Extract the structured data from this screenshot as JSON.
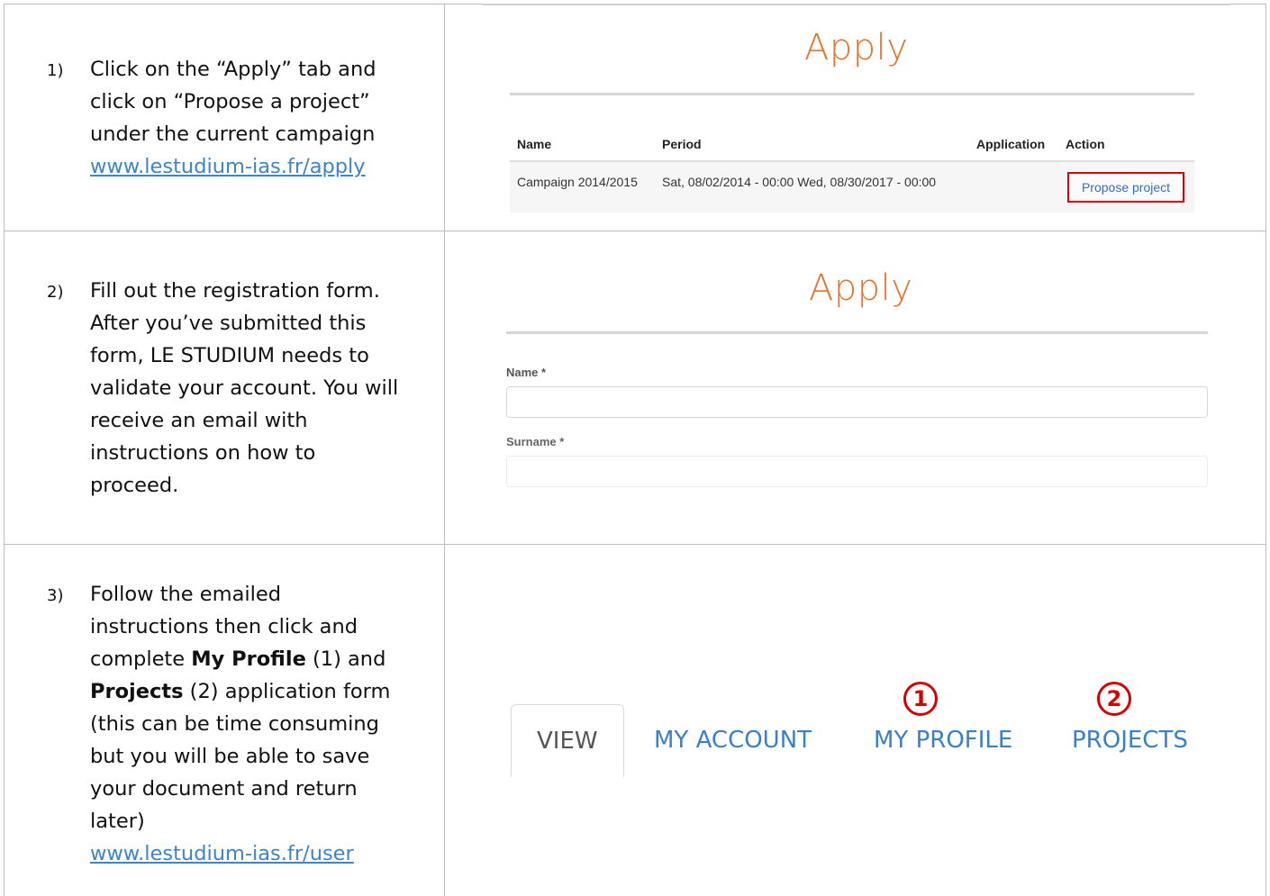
{
  "steps": [
    {
      "number": "1)",
      "text_lines": [
        "Click on the “Apply” tab and click on “Propose a project” under the current campaign"
      ],
      "link": "www.lestudium-ias.fr/apply"
    },
    {
      "number": "2)",
      "text": "Fill out the registration form. After you’ve submitted this form, LE STUDIUM needs to validate your account. You will receive an email with instructions on how to proceed."
    },
    {
      "number": "3)",
      "text_a": "Follow the emailed instructions then click and complete ",
      "bold_1": "My Profile",
      "text_b": " (1) and ",
      "bold_2": "Projects",
      "text_c": " (2) application form (this can be time consuming but you will be able to save your document and return later)",
      "link": "www.lestudium-ias.fr/user"
    }
  ],
  "panel1": {
    "title": "Apply",
    "headers": {
      "name": "Name",
      "period": "Period",
      "application": "Application",
      "action": "Action"
    },
    "row": {
      "name": "Campaign 2014/2015",
      "period": "Sat, 08/02/2014 - 00:00 Wed, 08/30/2017 - 00:00",
      "action_button": "Propose project"
    }
  },
  "panel2": {
    "title": "Apply",
    "fields": [
      {
        "label": "Name *"
      },
      {
        "label": "Surname *"
      }
    ]
  },
  "panel3": {
    "tabs": [
      "VIEW",
      "MY ACCOUNT",
      "MY PROFILE",
      "PROJECTS"
    ],
    "badges": [
      "1",
      "2"
    ],
    "badge_color": "#d40000",
    "link_color": "#3a80c8"
  },
  "colors": {
    "title": "#e8742c",
    "link": "#3d85c6",
    "highlight": "#e00000"
  }
}
